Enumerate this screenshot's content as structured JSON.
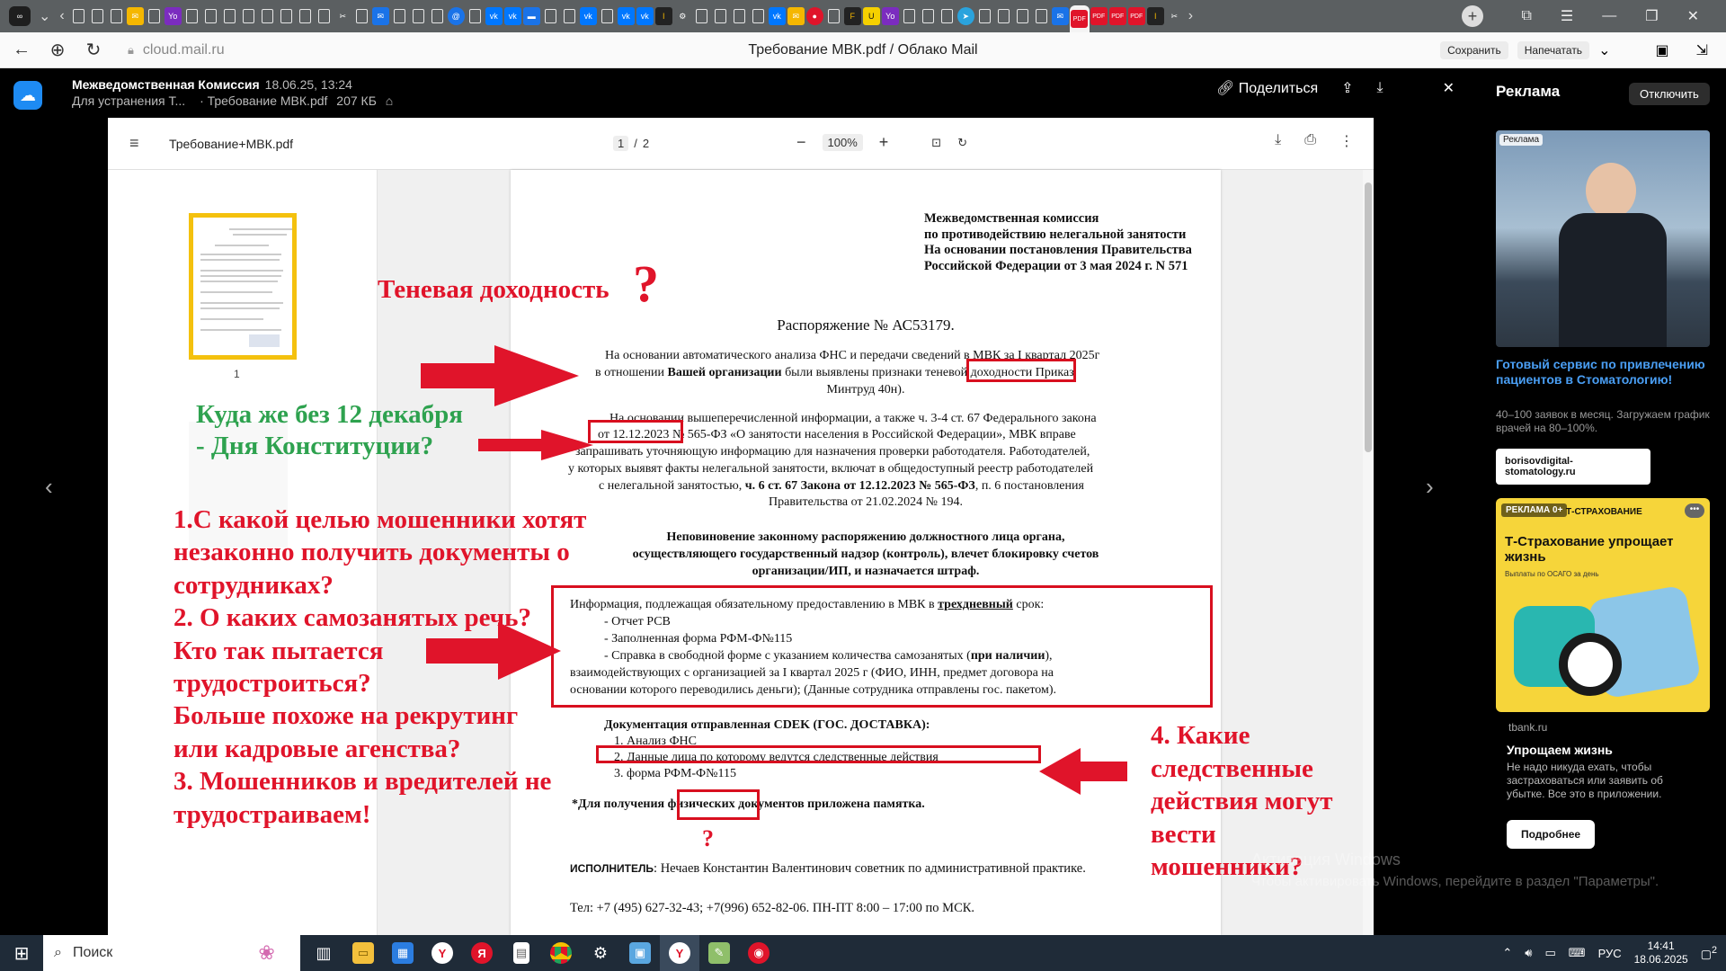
{
  "browser": {
    "url": "cloud.mail.ru",
    "page_title": "Требование МВК.pdf / Облако Mail",
    "save_label": "Сохранить",
    "print_label": "Напечатать"
  },
  "cloud_header": {
    "sender": "Межведомственная Комиссия",
    "date": "18.06.25, 13:24",
    "subject": "Для устранения Т...",
    "file_name": "· Требование МВК.pdf",
    "file_size": "207 КБ",
    "share_label": "Поделиться"
  },
  "viewer": {
    "file_name": "Требование+МВК.pdf",
    "page_current": "1",
    "page_sep": "/",
    "page_total": "2",
    "zoom": "100%",
    "thumb_page_number": "1"
  },
  "document": {
    "header": [
      "Межведомственная комиссия",
      "по противодействию нелегальной занятости",
      "На основании постановления Правительства",
      "Российской Федерации от 3 мая 2024 г. N 571"
    ],
    "order_title": "Распоряжение № АС53179.",
    "para1": [
      "На основании автоматического анализа ФНС и передачи сведений в МВК за I квартал 2025г",
      "в отношении Вашей организации были выявлены признаки теневой доходности Приказ",
      "Минтруд 40н)."
    ],
    "para1_highlight": "теневой доходности",
    "para2": [
      "На основании вышеперечисленной информации, а также ч. 3-4 ст. 67 Федерального закона",
      "от 12.12.2023 № 565-ФЗ «О занятости населения в Российской Федерации», МВК вправе",
      "запрашивать уточняющую информацию для назначения проверки работодателя. Работодателей,",
      "у которых выявят факты нелегальной занятости, включат в общедоступный реестр работодателей",
      "с нелегальной занятостью, ч. 6 ст. 67 Закона от 12.12.2023 № 565-ФЗ, п. 6 постановления",
      "Правительства от 21.02.2024 № 194."
    ],
    "para2_highlight": "от 12.12.2023",
    "warning": [
      "Неповиновение законному распоряжению должностного лица органа,",
      "осуществляющего государственный надзор (контроль), влечет блокировку счетов",
      "организации/ИП, и назначается штраф."
    ],
    "info_lines": [
      "Информация, подлежащая обязательному предоставлению в МВК в трехдневный срок:",
      "- Отчет РСВ",
      "- Заполненная форма РФМ-Ф№115",
      "- Справка в свободной форме с указанием количества самозанятых (при наличии),",
      "взаимодействующих с организацией за I квартал 2025 г (ФИО, ИНН, предмет договора на",
      "основании которого переводились деньги); (Данные сотрудника отправлены гос. пакетом)."
    ],
    "docs_title": "Документация отправленная CDEK (ГОС. ДОСТАВКА):",
    "docs_list": [
      "1.   Анализ ФНС",
      "2.   Данные лица по которому ведутся следственные действия",
      "3.   форма РФМ-Ф№115"
    ],
    "memo_note": "*Для получения физических документов приложена памятка.",
    "executor_label": "ИСПОЛНИТЕЛЬ",
    "executor_text": ": Нечаев Константин Валентинович советник по административной практике.",
    "phone_line": "Тел: +7 (495) 627-32-43; +7(996) 652-82-06. ПН-ПТ 8:00 – 17:00 по МСК."
  },
  "annotations": {
    "shadow_income": "Теневая доходность",
    "question_mark": "?",
    "december": [
      "Куда же без 12 декабря",
      "- Дня Конституции?"
    ],
    "questions": [
      "1.С какой целью мошенники хотят",
      "незаконно получить документы о",
      "сотрудниках?",
      "2. О каких самозанятых речь?",
      "Кто так пытается",
      "трудостроиться?",
      "Больше похоже на рекрутинг",
      "или кадровые агенства?",
      "3. Мошенников и вредителей не",
      "трудостраиваем!"
    ],
    "investigation": [
      "4. Какие",
      "следственные",
      "действия могут",
      "вести",
      "мошенники?"
    ],
    "small_question": "?",
    "colors": {
      "red": "#e0142a",
      "green": "#2ea24f",
      "box": "#d80f1f"
    }
  },
  "ads": {
    "panel_title": "Реклама",
    "disable_label": "Отключить",
    "ad1_badge": "Реклама",
    "ad1_headline": "Готовый сервис по привлечению пациентов в Стоматологию!",
    "ad1_desc": "40–100 заявок в месяц. Загружаем график врачей на 80–100%.",
    "ad1_link": "borisovdigital-stomatology.ru",
    "ad2_badge": "РЕКЛАМА 0+",
    "ad2_brand": "Т-СТРАХОВАНИЕ",
    "ad2_headline": "Т-Страхование упрощает жизнь",
    "ad2_sub": "Выплаты по ОСАГО за день",
    "ad2_domain": "tbank.ru",
    "ad2_title": "Упрощаем жизнь",
    "ad2_desc": "Не надо никуда ехать, чтобы застраховаться или заявить об убытке. Все это в приложении.",
    "ad2_button": "Подробнее"
  },
  "windows": {
    "activation_title": "Активация Windows",
    "activation_text": "Чтобы активировать Windows, перейдите в раздел \"Параметры\".",
    "search_label": "Поиск",
    "lang": "РУС",
    "time": "14:41",
    "date": "18.06.2025",
    "notif_count": "2"
  }
}
